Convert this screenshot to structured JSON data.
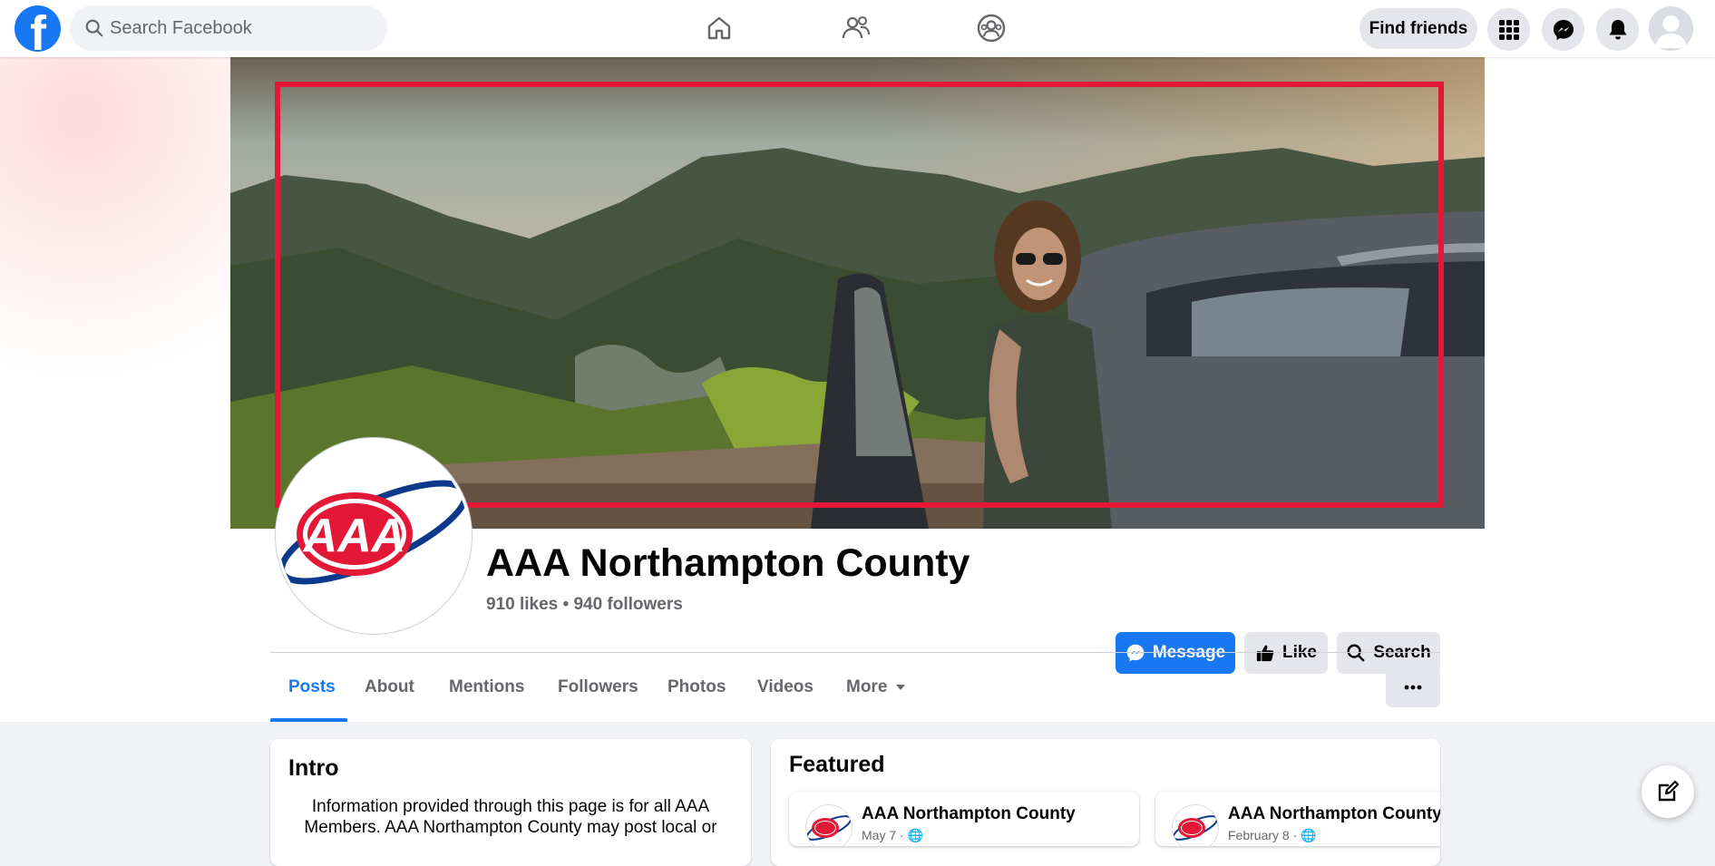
{
  "topbar": {
    "logo_letter": "f",
    "search_placeholder": "Search Facebook",
    "find_friends_label": "Find friends",
    "brand_color": "#1877f2",
    "nav_icons": [
      "home-icon",
      "friends-icon",
      "groups-icon"
    ],
    "right_icons": [
      "menu-grid-icon",
      "messenger-icon",
      "notifications-icon",
      "account-avatar"
    ]
  },
  "page": {
    "name": "AAA Northampton County",
    "stats": "910 likes • 940 followers",
    "logo_text": "AAA",
    "actions": {
      "message_label": "Message",
      "like_label": "Like",
      "search_label": "Search"
    }
  },
  "tabs": [
    {
      "label": "Posts",
      "active": true
    },
    {
      "label": "About"
    },
    {
      "label": "Mentions"
    },
    {
      "label": "Followers"
    },
    {
      "label": "Photos"
    },
    {
      "label": "Videos"
    },
    {
      "label": "More"
    }
  ],
  "intro": {
    "title": "Intro",
    "text": "Information provided through this page is for all AAA Members. AAA Northampton County may post local or"
  },
  "featured": {
    "title": "Featured",
    "items": [
      {
        "name": "AAA Northampton County",
        "meta": "May 7 · 🌐"
      },
      {
        "name": "AAA Northampton County",
        "meta": "February 8 · 🌐"
      }
    ]
  },
  "colors": {
    "accent": "#1877f2",
    "aaa_red": "#e31837",
    "aaa_blue": "#0b3a8c"
  }
}
